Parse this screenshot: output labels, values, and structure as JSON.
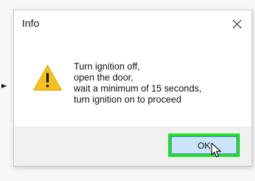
{
  "dialog": {
    "title": "Info",
    "close_icon": "close-icon",
    "message": "Turn ignition off,\nopen the door,\nwait a minimum of 15 seconds,\nturn ignition on to proceed",
    "icon": "warning-icon",
    "ok_label": "OK"
  },
  "colors": {
    "highlight": "#22e022",
    "warning_fill": "#f7c21a",
    "button_fill": "#cce4f7",
    "button_border": "#2d7fd1"
  }
}
